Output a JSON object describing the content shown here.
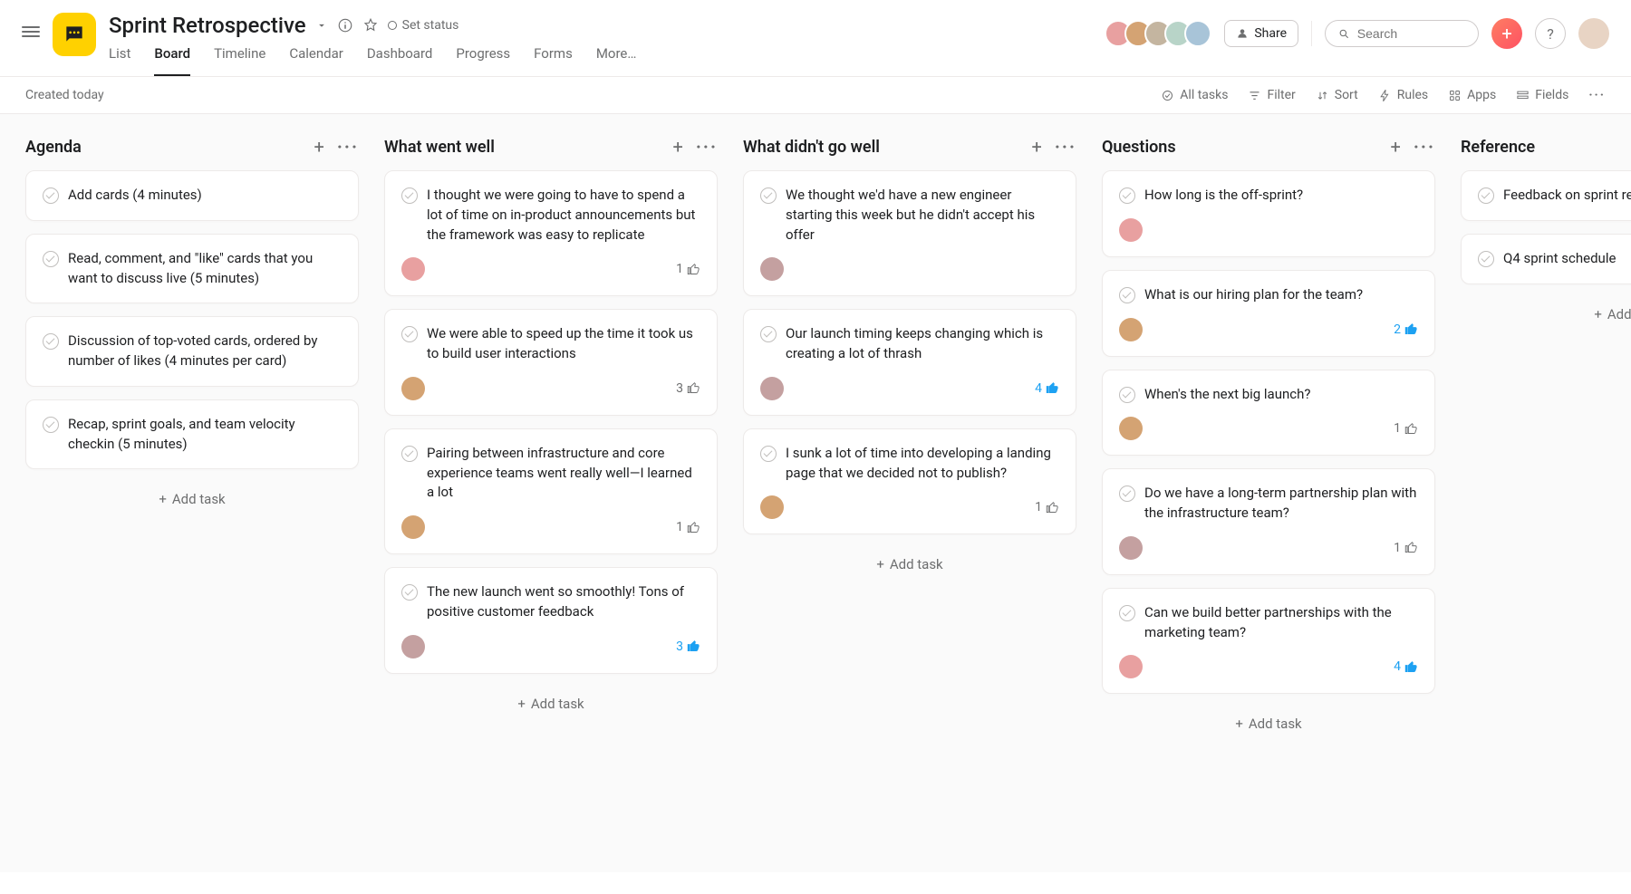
{
  "header": {
    "title": "Sprint Retrospective",
    "set_status": "Set status",
    "tabs": [
      "List",
      "Board",
      "Timeline",
      "Calendar",
      "Dashboard",
      "Progress",
      "Forms",
      "More…"
    ],
    "active_tab": "Board",
    "share": "Share",
    "search_placeholder": "Search",
    "avatar_colors": [
      "#e8a0a0",
      "#d4a373",
      "#c4b5a0",
      "#b8d4c8",
      "#a8c4d8"
    ]
  },
  "toolbar": {
    "created": "Created today",
    "items": [
      "All tasks",
      "Filter",
      "Sort",
      "Rules",
      "Apps",
      "Fields"
    ]
  },
  "columns": [
    {
      "title": "Agenda",
      "cards": [
        {
          "text": "Add cards (4 minutes)"
        },
        {
          "text": "Read, comment, and \"like\" cards that you want to discuss live (5 minutes)"
        },
        {
          "text": "Discussion of top-voted cards, ordered by number of likes (4 minutes per card)"
        },
        {
          "text": "Recap, sprint goals, and team velocity checkin (5 minutes)"
        }
      ],
      "add_label": "Add task"
    },
    {
      "title": "What went well",
      "cards": [
        {
          "text": "I thought we were going to have to spend a lot of time on in-product announcements but the framework was easy to replicate",
          "avatar": "#e8a0a0",
          "likes": 1,
          "lit": false
        },
        {
          "text": "We were able to speed up the time it took us to build user interactions",
          "avatar": "#d4a373",
          "likes": 3,
          "lit": false
        },
        {
          "text": "Pairing between infrastructure and core experience teams went really well—I learned a lot",
          "avatar": "#d4a373",
          "likes": 1,
          "lit": false
        },
        {
          "text": "The new launch went so smoothly! Tons of positive customer feedback",
          "avatar": "#c4a0a0",
          "likes": 3,
          "lit": true
        }
      ],
      "add_label": "Add task"
    },
    {
      "title": "What didn't go well",
      "cards": [
        {
          "text": "We thought we'd have a new engineer starting this week but he didn't accept his offer",
          "avatar": "#c4a0a0"
        },
        {
          "text": "Our launch timing keeps changing which is creating a lot of thrash",
          "avatar": "#c4a0a0",
          "likes": 4,
          "lit": true
        },
        {
          "text": "I sunk a lot of time into developing a landing page that we decided not to publish?",
          "avatar": "#d4a373",
          "likes": 1,
          "lit": false
        }
      ],
      "add_label": "Add task"
    },
    {
      "title": "Questions",
      "cards": [
        {
          "text": "How long is the off-sprint?",
          "avatar": "#e8a0a0"
        },
        {
          "text": "What is our hiring plan for the team?",
          "avatar": "#d4a373",
          "likes": 2,
          "lit": true
        },
        {
          "text": "When's the next big launch?",
          "avatar": "#d4a373",
          "likes": 1,
          "lit": false
        },
        {
          "text": "Do we have a long-term partnership plan with the infrastructure team?",
          "avatar": "#c4a0a0",
          "likes": 1,
          "lit": false
        },
        {
          "text": "Can we build better partnerships with the marketing team?",
          "avatar": "#e8a0a0",
          "likes": 4,
          "lit": true
        }
      ],
      "add_label": "Add task"
    },
    {
      "title": "Reference",
      "cards": [
        {
          "text": "Feedback on sprint retrospective meetings"
        },
        {
          "text": "Q4 sprint schedule"
        }
      ],
      "add_label": "Add task"
    }
  ]
}
